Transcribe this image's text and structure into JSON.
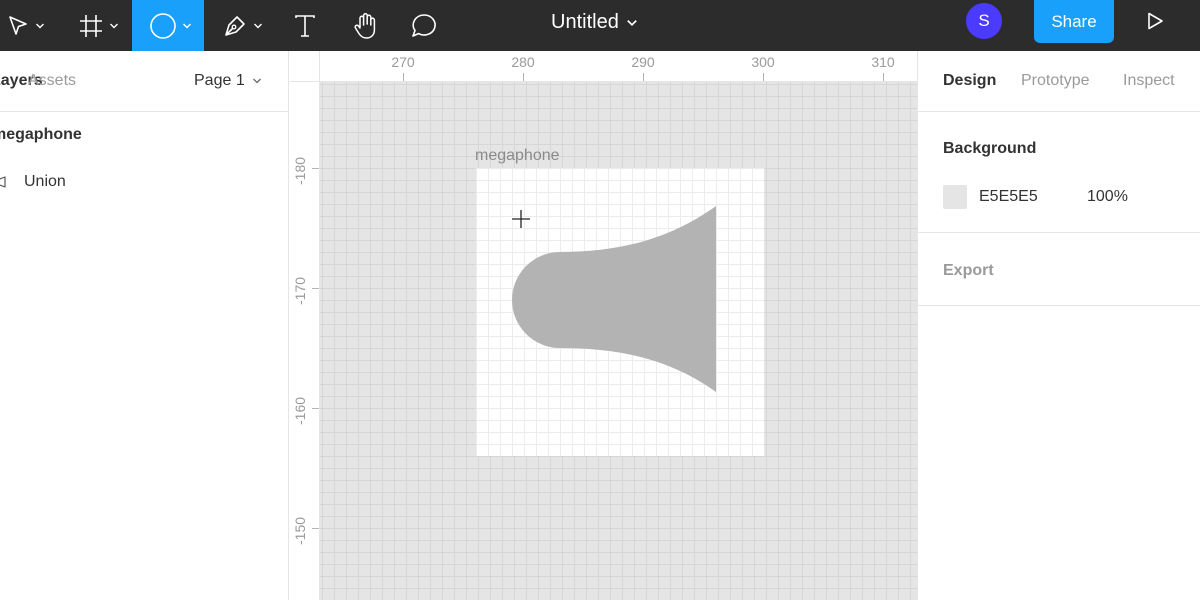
{
  "toolbar": {
    "tools": [
      {
        "name": "move-tool",
        "has_dropdown": true
      },
      {
        "name": "frame-tool",
        "has_dropdown": true
      },
      {
        "name": "ellipse-tool",
        "has_dropdown": true,
        "active": true
      },
      {
        "name": "pen-tool",
        "has_dropdown": true
      },
      {
        "name": "text-tool",
        "has_dropdown": false
      },
      {
        "name": "hand-tool",
        "has_dropdown": false
      },
      {
        "name": "comment-tool",
        "has_dropdown": false
      }
    ],
    "file_title": "Untitled",
    "avatar_initial": "S",
    "share_label": "Share",
    "colors": {
      "bar": "#2c2c2c",
      "accent": "#18a0fb",
      "avatar": "#4b3bff"
    }
  },
  "left_panel": {
    "tabs": {
      "layers": "Layers",
      "assets": "Assets"
    },
    "page_selector": "Page 1",
    "layers": {
      "frame": "megaphone",
      "child": "Union"
    }
  },
  "rulers": {
    "x_labels": [
      "270",
      "280",
      "290",
      "300",
      "310"
    ],
    "y_labels": [
      "-180",
      "-170",
      "-160",
      "-150"
    ]
  },
  "canvas": {
    "frame_name": "megaphone",
    "background": "#e5e5e5",
    "shape_fill": "#b3b3b3",
    "cursor": "crosshair-icon"
  },
  "right_panel": {
    "tabs": {
      "design": "Design",
      "prototype": "Prototype",
      "inspect": "Inspect"
    },
    "background": {
      "title": "Background",
      "color_hex": "E5E5E5",
      "swatch_color": "#e5e5e5",
      "opacity": "100%"
    },
    "export": {
      "title": "Export"
    }
  }
}
